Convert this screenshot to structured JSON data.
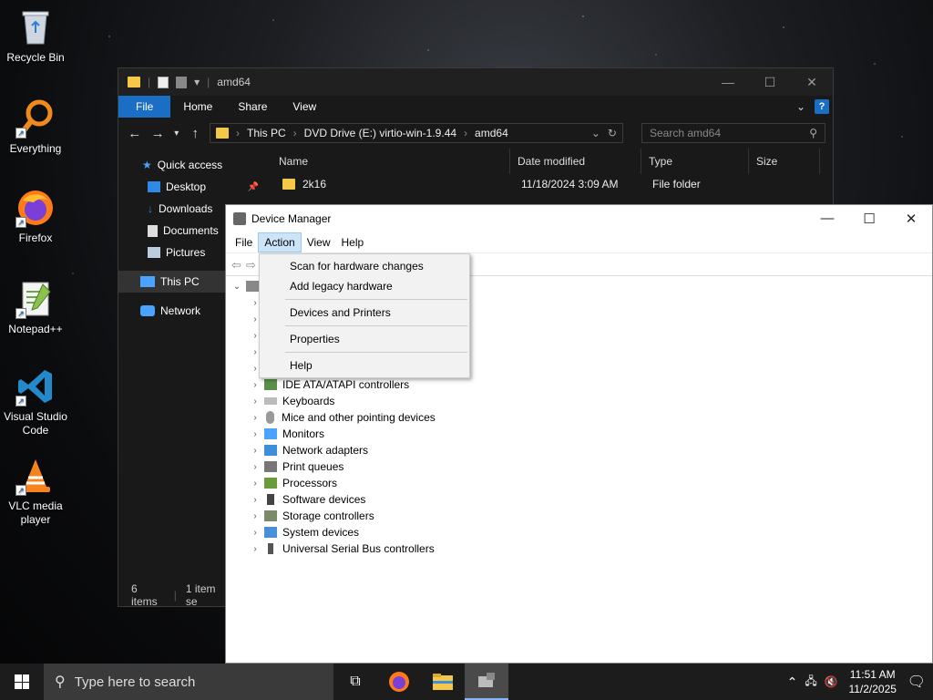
{
  "desktop": {
    "icons": [
      {
        "label": "Recycle Bin"
      },
      {
        "label": "Everything"
      },
      {
        "label": "Firefox"
      },
      {
        "label": "Notepad++"
      },
      {
        "label": "Visual Studio Code"
      },
      {
        "label": "VLC media player"
      }
    ]
  },
  "explorer": {
    "title": "amd64",
    "ribbon_tabs": [
      "File",
      "Home",
      "Share",
      "View"
    ],
    "breadcrumb": [
      "This PC",
      "DVD Drive (E:) virtio-win-1.9.44",
      "amd64"
    ],
    "search_placeholder": "Search amd64",
    "nav": {
      "quick_access": "Quick access",
      "desktop": "Desktop",
      "downloads": "Downloads",
      "documents": "Documents",
      "pictures": "Pictures",
      "this_pc": "This PC",
      "network": "Network"
    },
    "columns": [
      "Name",
      "Date modified",
      "Type",
      "Size"
    ],
    "rows": [
      {
        "name": "2k16",
        "date": "11/18/2024 3:09 AM",
        "type": "File folder"
      }
    ],
    "status_items": "6 items",
    "status_selected": "1 item se"
  },
  "devmgr": {
    "title": "Device Manager",
    "menu": [
      "File",
      "Action",
      "View",
      "Help"
    ],
    "action_menu": {
      "scan": "Scan for hardware changes",
      "add_legacy": "Add legacy hardware",
      "devices_printers": "Devices and Printers",
      "properties": "Properties",
      "help": "Help"
    },
    "tree": [
      "IDE ATA/ATAPI controllers",
      "Keyboards",
      "Mice and other pointing devices",
      "Monitors",
      "Network adapters",
      "Print queues",
      "Processors",
      "Software devices",
      "Storage controllers",
      "System devices",
      "Universal Serial Bus controllers"
    ]
  },
  "taskbar": {
    "search_placeholder": "Type here to search",
    "time": "11:51 AM",
    "date": "11/2/2025"
  },
  "colors": {
    "accent": "#1a6fc4",
    "folder": "#f5c84a",
    "menu_highlight": "#cce4f7"
  }
}
